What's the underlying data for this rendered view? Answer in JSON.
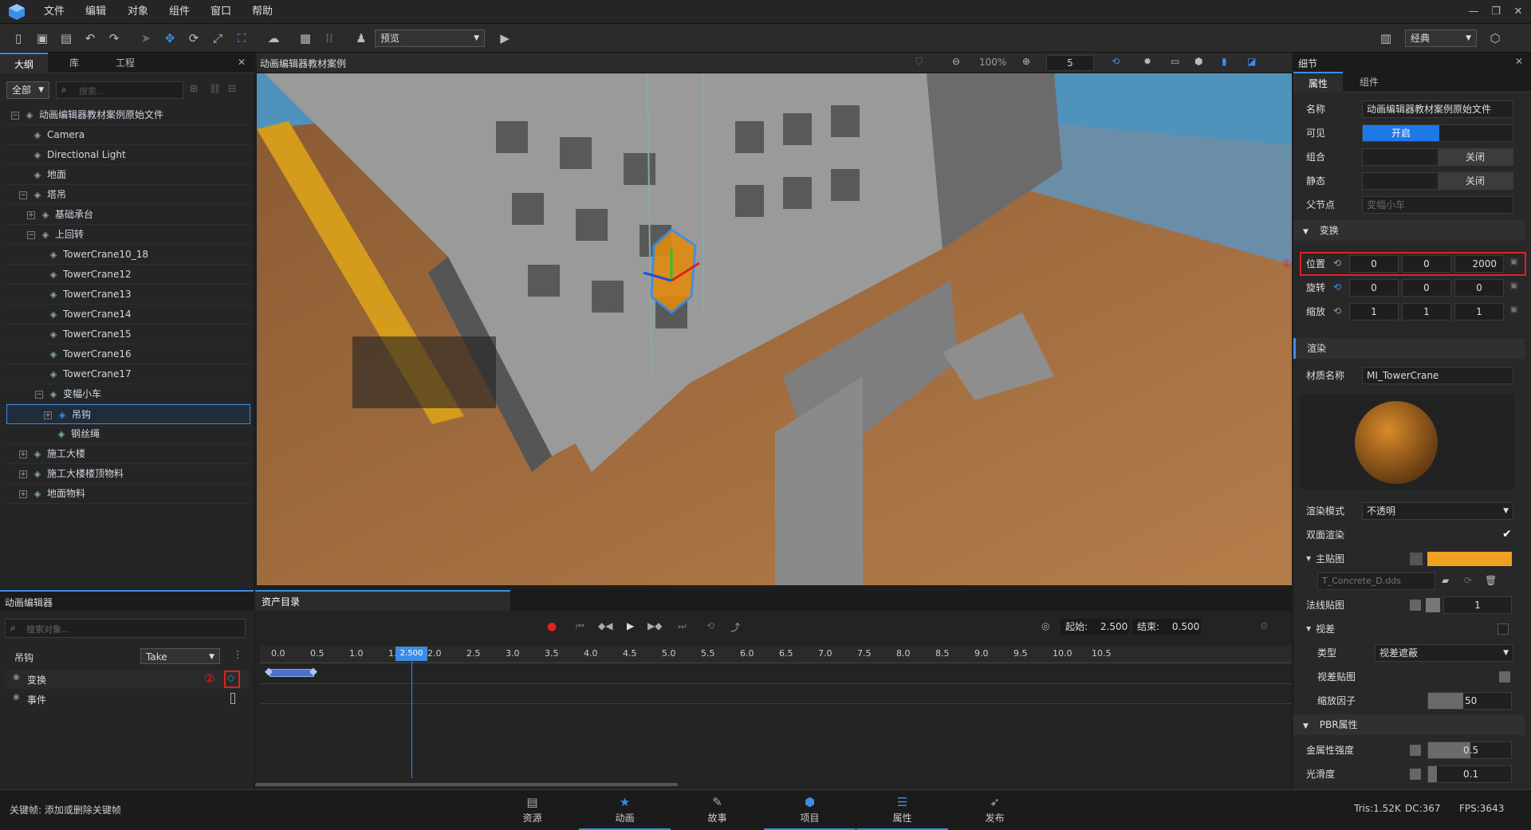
{
  "menu": [
    "文件",
    "编辑",
    "对象",
    "组件",
    "窗口",
    "帮助"
  ],
  "toolbar": {
    "mode_select": "预览",
    "layout_select": "经典"
  },
  "outline": {
    "tabs": [
      "大纲",
      "库",
      "工程"
    ],
    "filter": "全部",
    "search_placeholder": "搜索...",
    "tree": [
      {
        "label": "动画编辑器教材案例原始文件",
        "depth": 0,
        "exp": "−"
      },
      {
        "label": "Camera",
        "depth": 1,
        "exp": ""
      },
      {
        "label": "Directional Light",
        "depth": 1,
        "exp": ""
      },
      {
        "label": "地面",
        "depth": 1,
        "exp": ""
      },
      {
        "label": "塔吊",
        "depth": 1,
        "exp": "−"
      },
      {
        "label": "基础承台",
        "depth": 2,
        "exp": "+"
      },
      {
        "label": "上回转",
        "depth": 2,
        "exp": "−"
      },
      {
        "label": "TowerCrane10_18",
        "depth": 3,
        "exp": ""
      },
      {
        "label": "TowerCrane12",
        "depth": 3,
        "exp": ""
      },
      {
        "label": "TowerCrane13",
        "depth": 3,
        "exp": ""
      },
      {
        "label": "TowerCrane14",
        "depth": 3,
        "exp": ""
      },
      {
        "label": "TowerCrane15",
        "depth": 3,
        "exp": ""
      },
      {
        "label": "TowerCrane16",
        "depth": 3,
        "exp": ""
      },
      {
        "label": "TowerCrane17",
        "depth": 3,
        "exp": ""
      },
      {
        "label": "变幅小车",
        "depth": 3,
        "exp": "−"
      },
      {
        "label": "吊钩",
        "depth": 4,
        "exp": "+"
      },
      {
        "label": "钢丝绳",
        "depth": 4,
        "exp": ""
      },
      {
        "label": "施工大楼",
        "depth": 1,
        "exp": "+"
      },
      {
        "label": "施工大楼楼顶物料",
        "depth": 1,
        "exp": "+"
      },
      {
        "label": "地面物料",
        "depth": 1,
        "exp": "+"
      }
    ]
  },
  "viewport": {
    "title": "动画编辑器教材案例",
    "zoom": "100%",
    "speed": "5"
  },
  "details": {
    "title": "细节",
    "tabs": [
      "属性",
      "组件"
    ],
    "name_label": "名称",
    "name_value": "动画编辑器教材案例原始文件",
    "visible_label": "可见",
    "visible_value": "开启",
    "group_label": "组合",
    "group_value": "关闭",
    "static_label": "静态",
    "static_value": "关闭",
    "parent_label": "父节点",
    "parent_value": "变幅小车",
    "transform_section": "变换",
    "pos_label": "位置",
    "pos": [
      "0",
      "0",
      "2000"
    ],
    "rot_label": "旋转",
    "rot": [
      "0",
      "0",
      "0"
    ],
    "scale_label": "缩放",
    "scale": [
      "1",
      "1",
      "1"
    ],
    "render_section": "渲染",
    "material_label": "材质名称",
    "material_value": "MI_TowerCrane",
    "render_mode_label": "渲染模式",
    "render_mode_value": "不透明",
    "double_label": "双面渲染",
    "main_tex_label": "主贴图",
    "main_tex_file": "T_Concrete_D.dds",
    "normal_label": "法线贴图",
    "normal_value": "1",
    "parallax_label": "视差",
    "type_label": "类型",
    "type_value": "视差遮蔽",
    "parallax_tex_label": "视差贴图",
    "scale_factor_label": "缩放因子",
    "scale_factor_value": "50",
    "pbr_section": "PBR属性",
    "metal_label": "金属性强度",
    "metal_value": "0.5",
    "smooth_label": "光滑度",
    "smooth_value": "0.1",
    "mark1": "①",
    "mark2": "②"
  },
  "anim": {
    "title": "动画编辑器",
    "asset_tab": "资产目录",
    "search_placeholder": "搜索对象...",
    "object": "吊钩",
    "take": "Take",
    "tracks": [
      "变换",
      "事件"
    ],
    "start_label": "起始:",
    "start_value": "2.500",
    "end_label": "结束:",
    "end_value": "0.500",
    "playhead": "2.500",
    "ticks": [
      "0.0",
      "0.5",
      "1.0",
      "1.5",
      "2.0",
      "2.5",
      "3.0",
      "3.5",
      "4.0",
      "4.5",
      "5.0",
      "5.5",
      "6.0",
      "6.5",
      "7.0",
      "7.5",
      "8.0",
      "8.5",
      "9.0",
      "9.5",
      "10.0",
      "10.5"
    ]
  },
  "status": {
    "hint": "关键帧: 添加或删除关键帧",
    "tris": "Tris:1.52K",
    "dc": "DC:367",
    "fps": "FPS:3643"
  },
  "bottom_tabs": [
    "资源",
    "动画",
    "故事",
    "项目",
    "属性",
    "发布"
  ],
  "colors": {
    "accent": "#3a8ee6",
    "highlight": "#e02020",
    "albedo": "#f0a020"
  }
}
